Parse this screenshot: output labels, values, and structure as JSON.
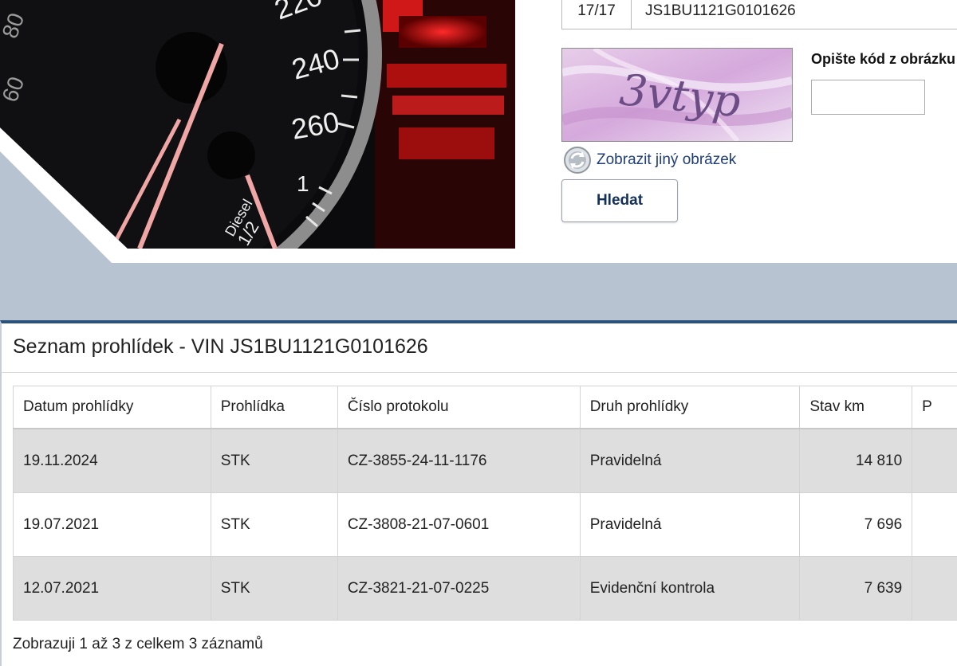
{
  "form": {
    "vin_count": "17/17",
    "vin_value": "JS1BU1121G0101626",
    "captcha_text": "3vtyp",
    "captcha_label": "Opište kód z obrázku",
    "captcha_input_value": "",
    "refresh_label": "Zobrazit jiný obrázek",
    "search_button": "Hledat"
  },
  "speedometer": {
    "labels": [
      "220",
      "240",
      "260",
      "1",
      "Diesel",
      "1/2"
    ]
  },
  "panel": {
    "title": "Seznam prohlídek - VIN JS1BU1121G0101626",
    "headers": [
      "Datum prohlídky",
      "Prohlídka",
      "Číslo protokolu",
      "Druh prohlídky",
      "Stav km",
      "P"
    ],
    "rows": [
      [
        "19.11.2024",
        "STK",
        "CZ-3855-24-11-1176",
        "Pravidelná",
        "14 810",
        ""
      ],
      [
        "19.07.2021",
        "STK",
        "CZ-3808-21-07-0601",
        "Pravidelná",
        "7 696",
        ""
      ],
      [
        "12.07.2021",
        "STK",
        "CZ-3821-21-07-0225",
        "Evidenční kontrola",
        "7 639",
        ""
      ]
    ],
    "info": "Zobrazuji 1 až 3 z celkem 3 záznamů"
  }
}
